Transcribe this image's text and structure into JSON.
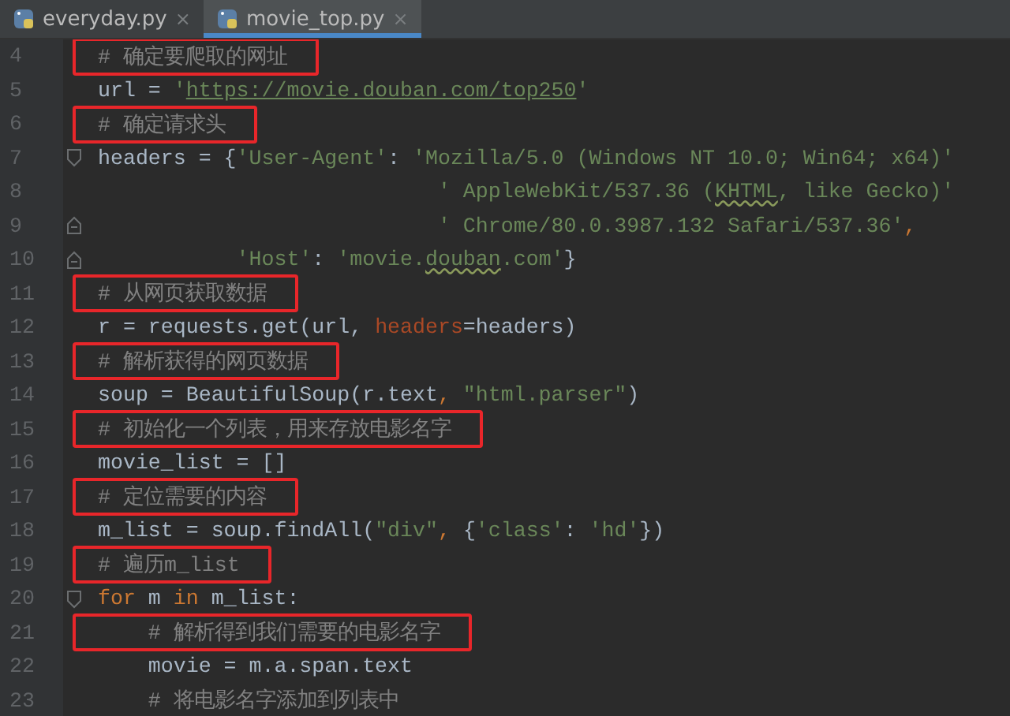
{
  "tabs": [
    {
      "label": "everyday.py",
      "close": "×",
      "selected": false
    },
    {
      "label": "movie_top.py",
      "close": "×",
      "selected": true
    }
  ],
  "editor": {
    "lines": [
      {
        "number": "4",
        "boxed": true,
        "tokens": [
          {
            "kind": "comment",
            "text": "# 确定要爬取的网址"
          }
        ]
      },
      {
        "number": "5",
        "boxed": false,
        "tokens": [
          {
            "kind": "plain",
            "text": "url = "
          },
          {
            "kind": "string",
            "text": "'"
          },
          {
            "kind": "link",
            "text": "https://movie.douban.com/top250"
          },
          {
            "kind": "string",
            "text": "'"
          }
        ]
      },
      {
        "number": "6",
        "boxed": true,
        "tokens": [
          {
            "kind": "comment",
            "text": "# 确定请求头"
          }
        ]
      },
      {
        "number": "7",
        "boxed": false,
        "fold_start": true,
        "tokens": [
          {
            "kind": "plain",
            "text": "headers = {"
          },
          {
            "kind": "string",
            "text": "'User-Agent'"
          },
          {
            "kind": "plain",
            "text": ": "
          },
          {
            "kind": "string",
            "text": "'Mozilla/5.0 (Windows NT 10.0; Win64; x64)'"
          }
        ]
      },
      {
        "number": "8",
        "boxed": false,
        "tokens": [
          {
            "kind": "string",
            "text": "                           ' AppleWebKit/537.36 ("
          },
          {
            "kind": "typo",
            "text": "KHTML"
          },
          {
            "kind": "string",
            "text": ", like Gecko)'"
          }
        ]
      },
      {
        "number": "9",
        "boxed": false,
        "fold_end": true,
        "tokens": [
          {
            "kind": "string",
            "text": "                           ' Chrome/80.0.3987.132 Safari/537.36'"
          },
          {
            "kind": "keyword",
            "text": ","
          }
        ]
      },
      {
        "number": "10",
        "boxed": false,
        "fold_end": true,
        "tokens": [
          {
            "kind": "string",
            "text": "           'Host'"
          },
          {
            "kind": "plain",
            "text": ": "
          },
          {
            "kind": "string",
            "text": "'movie."
          },
          {
            "kind": "typo",
            "text": "douban"
          },
          {
            "kind": "string",
            "text": ".com'"
          },
          {
            "kind": "plain",
            "text": "}"
          }
        ]
      },
      {
        "number": "11",
        "boxed": true,
        "tokens": [
          {
            "kind": "comment",
            "text": "# 从网页获取数据"
          }
        ]
      },
      {
        "number": "12",
        "boxed": false,
        "tokens": [
          {
            "kind": "plain",
            "text": "r = requests.get(url, "
          },
          {
            "kind": "param",
            "text": "headers"
          },
          {
            "kind": "plain",
            "text": "=headers)"
          }
        ]
      },
      {
        "number": "13",
        "boxed": true,
        "tokens": [
          {
            "kind": "comment",
            "text": "# 解析获得的网页数据"
          }
        ]
      },
      {
        "number": "14",
        "boxed": false,
        "tokens": [
          {
            "kind": "plain",
            "text": "soup = BeautifulSoup(r.text"
          },
          {
            "kind": "keyword",
            "text": ", "
          },
          {
            "kind": "string",
            "text": "\"html.parser\""
          },
          {
            "kind": "plain",
            "text": ")"
          }
        ]
      },
      {
        "number": "15",
        "boxed": true,
        "tokens": [
          {
            "kind": "comment",
            "text": "# 初始化一个列表，用来存放电影名字"
          }
        ]
      },
      {
        "number": "16",
        "boxed": false,
        "tokens": [
          {
            "kind": "plain",
            "text": "movie_list = []"
          }
        ]
      },
      {
        "number": "17",
        "boxed": true,
        "tokens": [
          {
            "kind": "comment",
            "text": "# 定位需要的内容"
          }
        ]
      },
      {
        "number": "18",
        "boxed": false,
        "tokens": [
          {
            "kind": "plain",
            "text": "m_list = soup.findAll("
          },
          {
            "kind": "string",
            "text": "\"div\""
          },
          {
            "kind": "keyword",
            "text": ", "
          },
          {
            "kind": "plain",
            "text": "{"
          },
          {
            "kind": "string",
            "text": "'class'"
          },
          {
            "kind": "plain",
            "text": ": "
          },
          {
            "kind": "string",
            "text": "'hd'"
          },
          {
            "kind": "plain",
            "text": "})"
          }
        ]
      },
      {
        "number": "19",
        "boxed": true,
        "tokens": [
          {
            "kind": "comment",
            "text": "# 遍历m_list"
          }
        ]
      },
      {
        "number": "20",
        "boxed": false,
        "fold_start": true,
        "tokens": [
          {
            "kind": "keyword",
            "text": "for"
          },
          {
            "kind": "plain",
            "text": " m "
          },
          {
            "kind": "keyword",
            "text": "in"
          },
          {
            "kind": "plain",
            "text": " m_list:"
          }
        ]
      },
      {
        "number": "21",
        "boxed": true,
        "tokens": [
          {
            "kind": "comment",
            "text": "    # 解析得到我们需要的电影名字"
          }
        ]
      },
      {
        "number": "22",
        "boxed": false,
        "tokens": [
          {
            "kind": "plain",
            "text": "    movie = m.a.span.text"
          }
        ]
      },
      {
        "number": "23",
        "boxed": false,
        "tokens": [
          {
            "kind": "comment",
            "text": "    # 将电影名字添加到列表中"
          }
        ]
      }
    ]
  }
}
